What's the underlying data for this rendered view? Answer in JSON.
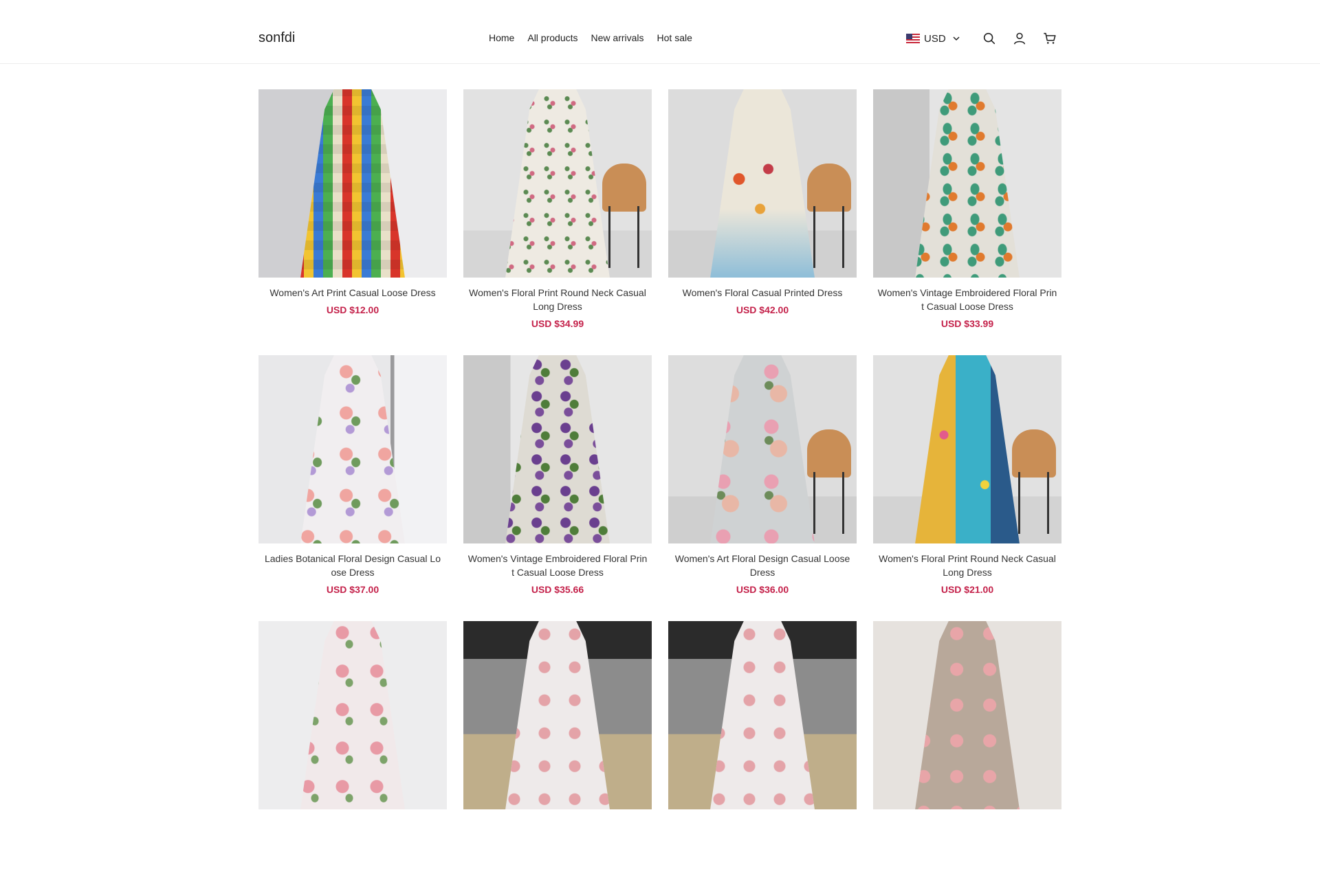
{
  "brand": {
    "name": "sonfdi"
  },
  "nav": {
    "items": [
      "Home",
      "All products",
      "New arrivals",
      "Hot sale"
    ]
  },
  "header": {
    "currency": "USD",
    "icons": [
      "search-icon",
      "account-icon",
      "cart-icon"
    ]
  },
  "products": [
    {
      "title": "Women's Art Print Casual Loose Dress",
      "price": "USD $12.00"
    },
    {
      "title": "Women's Floral Print Round Neck Casual Long Dress",
      "price": "USD $34.99"
    },
    {
      "title": "Women's Floral Casual Printed Dress",
      "price": "USD $42.00"
    },
    {
      "title": "Women's Vintage Embroidered Floral Print Casual Loose Dress",
      "price": "USD $33.99"
    },
    {
      "title": "Ladies Botanical Floral Design Casual Loose Dress",
      "price": "USD $37.00"
    },
    {
      "title": "Women's Vintage Embroidered Floral Print Casual Loose Dress",
      "price": "USD $35.66"
    },
    {
      "title": "Women's Art Floral Design Casual Loose Dress",
      "price": "USD $36.00"
    },
    {
      "title": "Women's Floral Print Round Neck Casual Long Dress",
      "price": "USD $21.00"
    },
    {
      "title": "",
      "price": ""
    },
    {
      "title": "",
      "price": ""
    },
    {
      "title": "",
      "price": ""
    },
    {
      "title": "",
      "price": ""
    }
  ],
  "colors": {
    "price": "#c4214a",
    "text": "#222222",
    "border": "#ececec"
  }
}
